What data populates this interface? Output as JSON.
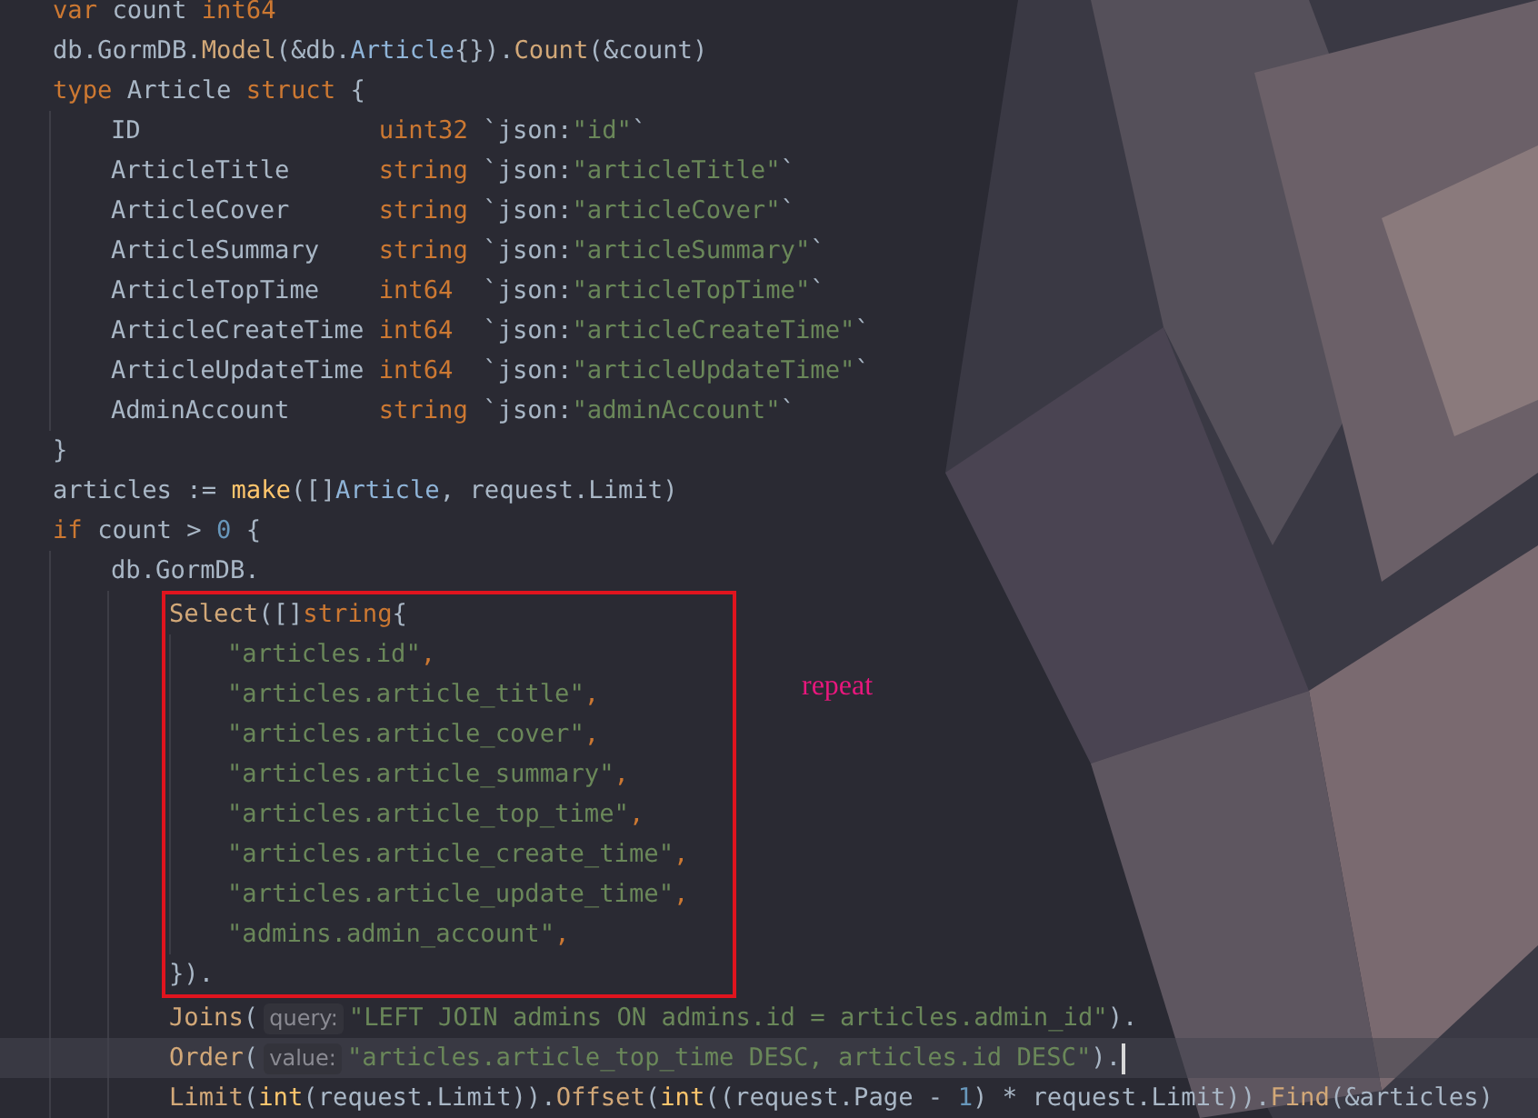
{
  "editor": {
    "lines": [
      {
        "tokens": [
          {
            "text": "var ",
            "kind": "keyword"
          },
          {
            "text": "count ",
            "kind": "plain"
          },
          {
            "text": "int64",
            "kind": "keyword"
          }
        ]
      },
      {
        "tokens": [
          {
            "text": "db.GormDB.",
            "kind": "plain"
          },
          {
            "text": "Model",
            "kind": "method"
          },
          {
            "text": "(&db.",
            "kind": "plain"
          },
          {
            "text": "Article",
            "kind": "type"
          },
          {
            "text": "{}).",
            "kind": "plain"
          },
          {
            "text": "Count",
            "kind": "method"
          },
          {
            "text": "(&count)",
            "kind": "plain"
          }
        ]
      },
      {
        "tokens": [
          {
            "text": "type ",
            "kind": "keyword"
          },
          {
            "text": "Article ",
            "kind": "plain"
          },
          {
            "text": "struct ",
            "kind": "keyword"
          },
          {
            "text": "{",
            "kind": "plain"
          }
        ],
        "fields": [
          {
            "name": "ID",
            "type": "uint32",
            "tag_key": "`json:",
            "tag_value": "\"id\"",
            "tag_end": "`"
          },
          {
            "name": "ArticleTitle",
            "type": "string",
            "tag_key": "`json:",
            "tag_value": "\"articleTitle\"",
            "tag_end": "`"
          },
          {
            "name": "ArticleCover",
            "type": "string",
            "tag_key": "`json:",
            "tag_value": "\"articleCover\"",
            "tag_end": "`"
          },
          {
            "name": "ArticleSummary",
            "type": "string",
            "tag_key": "`json:",
            "tag_value": "\"articleSummary\"",
            "tag_end": "`"
          },
          {
            "name": "ArticleTopTime",
            "type": "int64",
            "tag_key": "`json:",
            "tag_value": "\"articleTopTime\"",
            "tag_end": "`"
          },
          {
            "name": "ArticleCreateTime",
            "type": "int64",
            "tag_key": "`json:",
            "tag_value": "\"articleCreateTime\"",
            "tag_end": "`"
          },
          {
            "name": "ArticleUpdateTime",
            "type": "int64",
            "tag_key": "`json:",
            "tag_value": "\"articleUpdateTime\"",
            "tag_end": "`"
          },
          {
            "name": "AdminAccount",
            "type": "string",
            "tag_key": "`json:",
            "tag_value": "\"adminAccount\"",
            "tag_end": "`"
          }
        ]
      },
      {
        "tokens": [
          {
            "text": "}",
            "kind": "plain"
          }
        ]
      },
      {
        "tokens": [
          {
            "text": "articles := ",
            "kind": "plain"
          },
          {
            "text": "make",
            "kind": "builtin"
          },
          {
            "text": "([]",
            "kind": "plain"
          },
          {
            "text": "Article",
            "kind": "type"
          },
          {
            "text": ", request.Limit)",
            "kind": "plain"
          }
        ]
      },
      {
        "tokens": [
          {
            "text": "if ",
            "kind": "keyword"
          },
          {
            "text": "count > ",
            "kind": "plain"
          },
          {
            "text": "0",
            "kind": "number"
          },
          {
            "text": " {",
            "kind": "plain"
          }
        ],
        "children": [
          {
            "tokens": [
              {
                "text": "db.GormDB.",
                "kind": "plain"
              }
            ],
            "children": [
              {
                "kind": "boxed",
                "annotation": "repeat",
                "lines": [
                  {
                    "tokens": [
                      {
                        "text": "Select",
                        "kind": "method"
                      },
                      {
                        "text": "([]",
                        "kind": "plain"
                      },
                      {
                        "text": "string",
                        "kind": "keyword"
                      },
                      {
                        "text": "{",
                        "kind": "plain"
                      }
                    ],
                    "children": [
                      {
                        "tokens": [
                          {
                            "text": "\"articles.id\"",
                            "kind": "string"
                          },
                          {
                            "text": ",",
                            "kind": "keyword"
                          }
                        ]
                      },
                      {
                        "tokens": [
                          {
                            "text": "\"articles.article_title\"",
                            "kind": "string"
                          },
                          {
                            "text": ",",
                            "kind": "keyword"
                          }
                        ]
                      },
                      {
                        "tokens": [
                          {
                            "text": "\"articles.article_cover\"",
                            "kind": "string"
                          },
                          {
                            "text": ",",
                            "kind": "keyword"
                          }
                        ]
                      },
                      {
                        "tokens": [
                          {
                            "text": "\"articles.article_summary\"",
                            "kind": "string"
                          },
                          {
                            "text": ",",
                            "kind": "keyword"
                          }
                        ]
                      },
                      {
                        "tokens": [
                          {
                            "text": "\"articles.article_top_time\"",
                            "kind": "string"
                          },
                          {
                            "text": ",",
                            "kind": "keyword"
                          }
                        ]
                      },
                      {
                        "tokens": [
                          {
                            "text": "\"articles.article_create_time\"",
                            "kind": "string"
                          },
                          {
                            "text": ",",
                            "kind": "keyword"
                          }
                        ]
                      },
                      {
                        "tokens": [
                          {
                            "text": "\"articles.article_update_time\"",
                            "kind": "string"
                          },
                          {
                            "text": ",",
                            "kind": "keyword"
                          }
                        ]
                      },
                      {
                        "tokens": [
                          {
                            "text": "\"admins.admin_account\"",
                            "kind": "string"
                          },
                          {
                            "text": ",",
                            "kind": "keyword"
                          }
                        ]
                      }
                    ]
                  },
                  {
                    "tokens": [
                      {
                        "text": "}).",
                        "kind": "plain"
                      }
                    ]
                  }
                ]
              },
              {
                "tokens": [
                  {
                    "text": "Joins",
                    "kind": "method"
                  },
                  {
                    "text": "(",
                    "kind": "plain"
                  },
                  {
                    "text": "query:",
                    "kind": "hint"
                  },
                  {
                    "text": "\"LEFT JOIN admins ON admins.id = articles.admin_id\"",
                    "kind": "string"
                  },
                  {
                    "text": ").",
                    "kind": "plain"
                  }
                ]
              },
              {
                "current": true,
                "tokens": [
                  {
                    "text": "Order",
                    "kind": "method"
                  },
                  {
                    "text": "(",
                    "kind": "plain"
                  },
                  {
                    "text": "value:",
                    "kind": "hint"
                  },
                  {
                    "text": "\"articles.article_top_time DESC, articles.id DESC\"",
                    "kind": "string"
                  },
                  {
                    "text": ").",
                    "kind": "plain"
                  }
                ]
              },
              {
                "tokens": [
                  {
                    "text": "Limit",
                    "kind": "method"
                  },
                  {
                    "text": "(",
                    "kind": "plain"
                  },
                  {
                    "text": "int",
                    "kind": "builtin"
                  },
                  {
                    "text": "(request.Limit)).",
                    "kind": "plain"
                  },
                  {
                    "text": "Offset",
                    "kind": "method"
                  },
                  {
                    "text": "(",
                    "kind": "plain"
                  },
                  {
                    "text": "int",
                    "kind": "builtin"
                  },
                  {
                    "text": "((request.Page - ",
                    "kind": "plain"
                  },
                  {
                    "text": "1",
                    "kind": "number"
                  },
                  {
                    "text": ") * request.Limit)).",
                    "kind": "plain"
                  },
                  {
                    "text": "Find",
                    "kind": "method"
                  },
                  {
                    "text": "(&articles)",
                    "kind": "plain"
                  }
                ]
              }
            ]
          }
        ]
      }
    ]
  }
}
